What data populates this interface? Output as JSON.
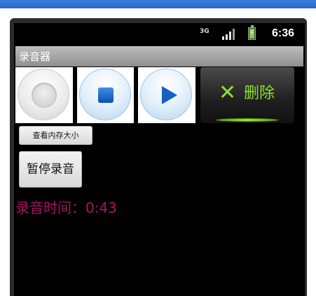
{
  "window": {
    "title": ""
  },
  "statusbar": {
    "network": "3G",
    "time": "6:36",
    "signal_bars": 4,
    "battery_level": 0.85,
    "icons": [
      "3g-icon",
      "signal-icon",
      "battery-charging-icon"
    ]
  },
  "app": {
    "title": "录音器"
  },
  "controls": {
    "record": {
      "icon": "record-icon"
    },
    "stop": {
      "icon": "stop-icon"
    },
    "play": {
      "icon": "play-icon"
    },
    "delete": {
      "icon": "close-icon",
      "symbol": "✕",
      "label": "删除"
    }
  },
  "buttons": {
    "memory_label": "查看内存大小",
    "pause_label": "暂停录音"
  },
  "timer": {
    "text": "录音时间：0:43"
  },
  "colors": {
    "screen_bg": "#000000",
    "appbar": "#a8a8a8",
    "delete_accent": "#8ee02a",
    "timer_text": "#a5145f",
    "play_blue": "#1560c4"
  }
}
